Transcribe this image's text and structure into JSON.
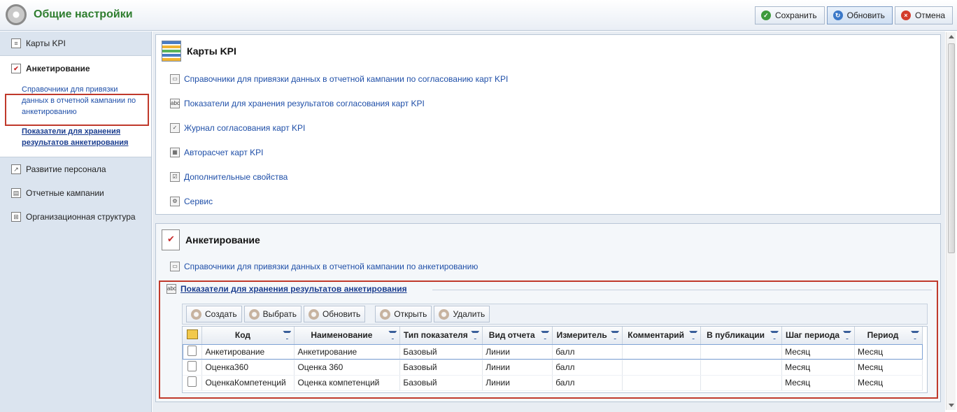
{
  "header": {
    "title": "Общие настройки"
  },
  "toolbar": {
    "save": "Сохранить",
    "refresh": "Обновить",
    "cancel": "Отмена"
  },
  "sidebar": {
    "items": [
      {
        "label": "Карты KPI",
        "icon": "list-icon"
      },
      {
        "label": "Анкетирование",
        "icon": "questionnaire-icon"
      },
      {
        "label": "Развитие персонала",
        "icon": "chart-icon"
      },
      {
        "label": "Отчетные кампании",
        "icon": "table-icon"
      },
      {
        "label": "Организационная структура",
        "icon": "org-structure-icon"
      }
    ],
    "sub_links": [
      "Справочники для привязки данных в отчетной кампании по анкетированию",
      "Показатели для хранения результатов анкетирования"
    ]
  },
  "panel_kpi": {
    "title": "Карты KPI",
    "links": [
      "Справочники для привязки данных в отчетной кампании по согласованию карт KPI",
      "Показатели для хранения результатов согласования карт KPI",
      "Журнал согласования карт KPI",
      "Авторасчет карт KPI",
      "Дополнительные свойства",
      "Сервис"
    ]
  },
  "panel_survey": {
    "title": "Анкетирование",
    "link": "Справочники для привязки данных в отчетной кампании по анкетированию",
    "section_title": "Показатели для хранения результатов анкетирования",
    "grid_toolbar": {
      "create": "Создать",
      "select": "Выбрать",
      "refresh": "Обновить",
      "open": "Открыть",
      "delete": "Удалить"
    },
    "columns": [
      "Код",
      "Наименование",
      "Тип показателя",
      "Вид отчета",
      "Измеритель",
      "Комментарий",
      "В публикации",
      "Шаг периода",
      "Период"
    ],
    "rows": [
      [
        "Анкетирование",
        "Анкетирование",
        "Базовый",
        "Линии",
        "балл",
        "",
        "",
        "Месяц",
        "Месяц"
      ],
      [
        "Оценка360",
        "Оценка 360",
        "Базовый",
        "Линии",
        "балл",
        "",
        "",
        "Месяц",
        "Месяц"
      ],
      [
        "ОценкаКомпетенций",
        "Оценка компетенций",
        "Базовый",
        "Линии",
        "балл",
        "",
        "",
        "Месяц",
        "Месяц"
      ]
    ]
  }
}
